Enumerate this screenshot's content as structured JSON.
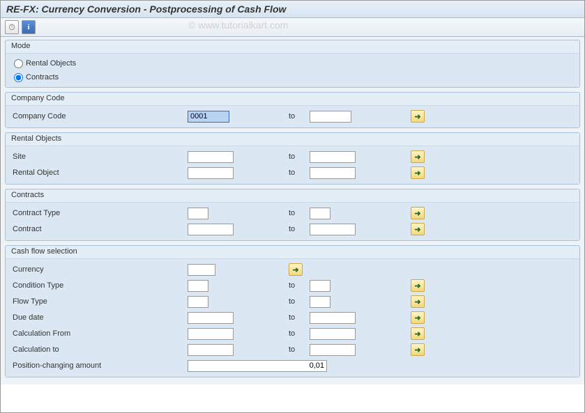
{
  "title": "RE-FX: Currency Conversion - Postprocessing of Cash Flow",
  "watermark": "© www.tutorialkart.com",
  "groups": {
    "mode": {
      "title": "Mode",
      "options": {
        "rental_objects": "Rental Objects",
        "contracts": "Contracts"
      },
      "selected": "contracts"
    },
    "company_code": {
      "title": "Company Code",
      "label": "Company Code",
      "from": "0001",
      "to_label": "to",
      "to": ""
    },
    "rental_objects": {
      "title": "Rental Objects",
      "rows": [
        {
          "label": "Site",
          "from": "",
          "to_label": "to",
          "to": ""
        },
        {
          "label": "Rental Object",
          "from": "",
          "to_label": "to",
          "to": ""
        }
      ]
    },
    "contracts": {
      "title": "Contracts",
      "rows": [
        {
          "label": "Contract Type",
          "from": "",
          "to_label": "to",
          "to": "",
          "narrow": true
        },
        {
          "label": "Contract",
          "from": "",
          "to_label": "to",
          "to": "",
          "narrow": false
        }
      ]
    },
    "cash_flow": {
      "title": "Cash flow selection",
      "rows": [
        {
          "label": "Currency",
          "from": "",
          "to_label": "",
          "to": "",
          "single": true
        },
        {
          "label": "Condition Type",
          "from": "",
          "to_label": "to",
          "to": "",
          "narrow": true
        },
        {
          "label": "Flow Type",
          "from": "",
          "to_label": "to",
          "to": "",
          "narrow": true
        },
        {
          "label": "Due date",
          "from": "",
          "to_label": "to",
          "to": ""
        },
        {
          "label": "Calculation From",
          "from": "",
          "to_label": "to",
          "to": ""
        },
        {
          "label": "Calculation to",
          "from": "",
          "to_label": "to",
          "to": ""
        }
      ],
      "amount": {
        "label": "Position-changing amount",
        "value": "0,01"
      }
    }
  }
}
